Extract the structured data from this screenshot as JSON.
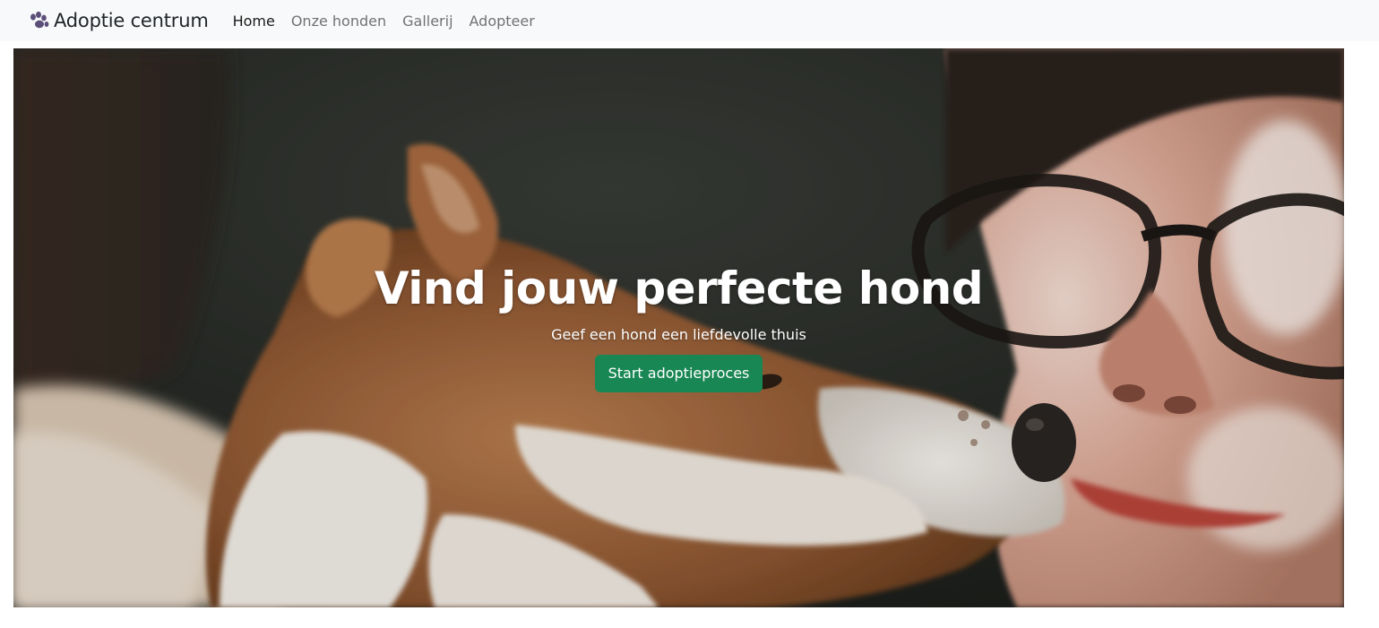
{
  "navbar": {
    "brand_icon": "paw-icon",
    "brand_text": "Adoptie centrum",
    "links": [
      {
        "label": "Home",
        "active": true
      },
      {
        "label": "Onze honden",
        "active": false
      },
      {
        "label": "Gallerij",
        "active": false
      },
      {
        "label": "Adopteer",
        "active": false
      }
    ]
  },
  "hero": {
    "title": "Vind jouw perfecte hond",
    "subtitle": "Geef een hond een liefdevolle thuis",
    "cta_label": "Start adoptieproces"
  },
  "colors": {
    "navbar_bg": "#f8f9fa",
    "cta_bg": "#198754",
    "text_light": "#ffffff"
  }
}
